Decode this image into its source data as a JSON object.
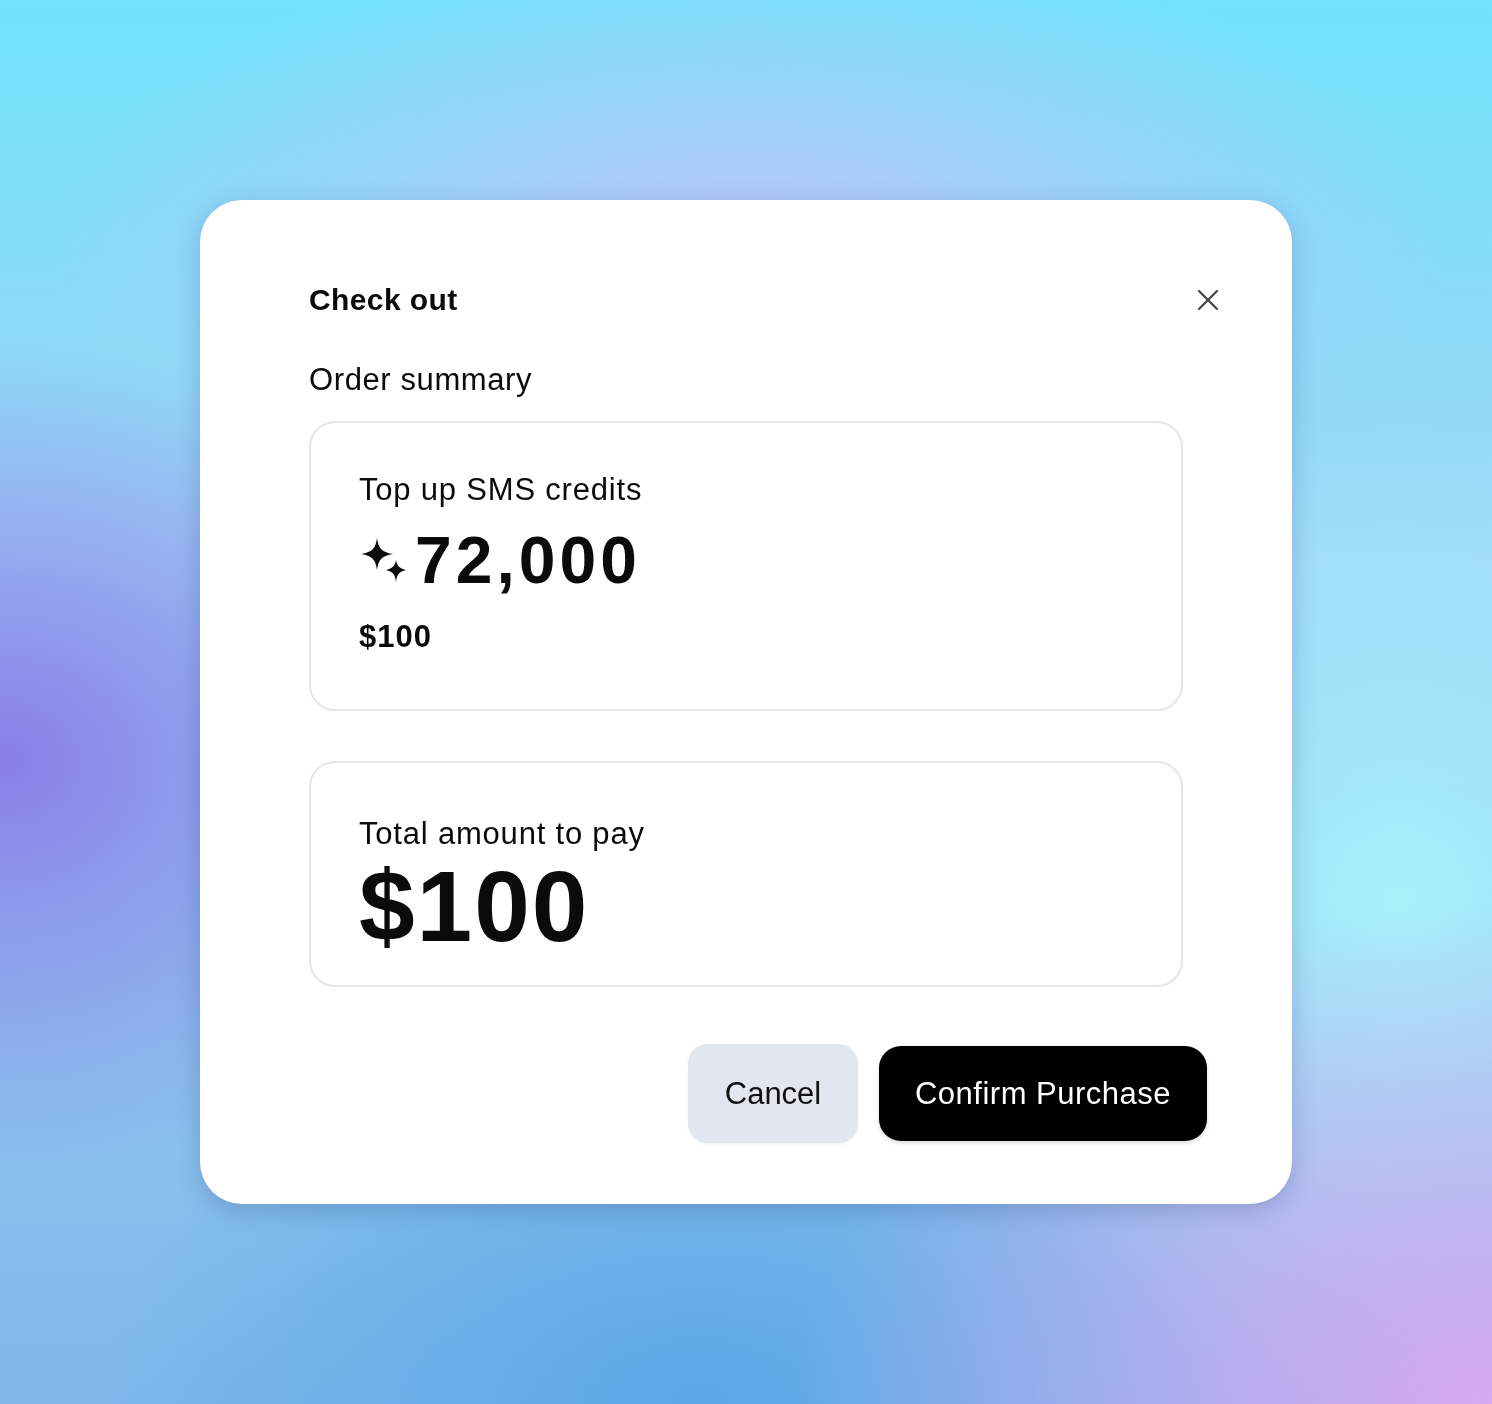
{
  "dialog": {
    "title": "Check out",
    "section_label": "Order summary",
    "order_item": {
      "label": "Top up SMS credits",
      "credits": "72,000",
      "price": "$100"
    },
    "total": {
      "label": "Total amount to pay",
      "amount": "$100"
    },
    "buttons": [
      {
        "label": "Cancel",
        "kind": "secondary"
      },
      {
        "label": "Confirm Purchase",
        "kind": "primary"
      }
    ]
  }
}
